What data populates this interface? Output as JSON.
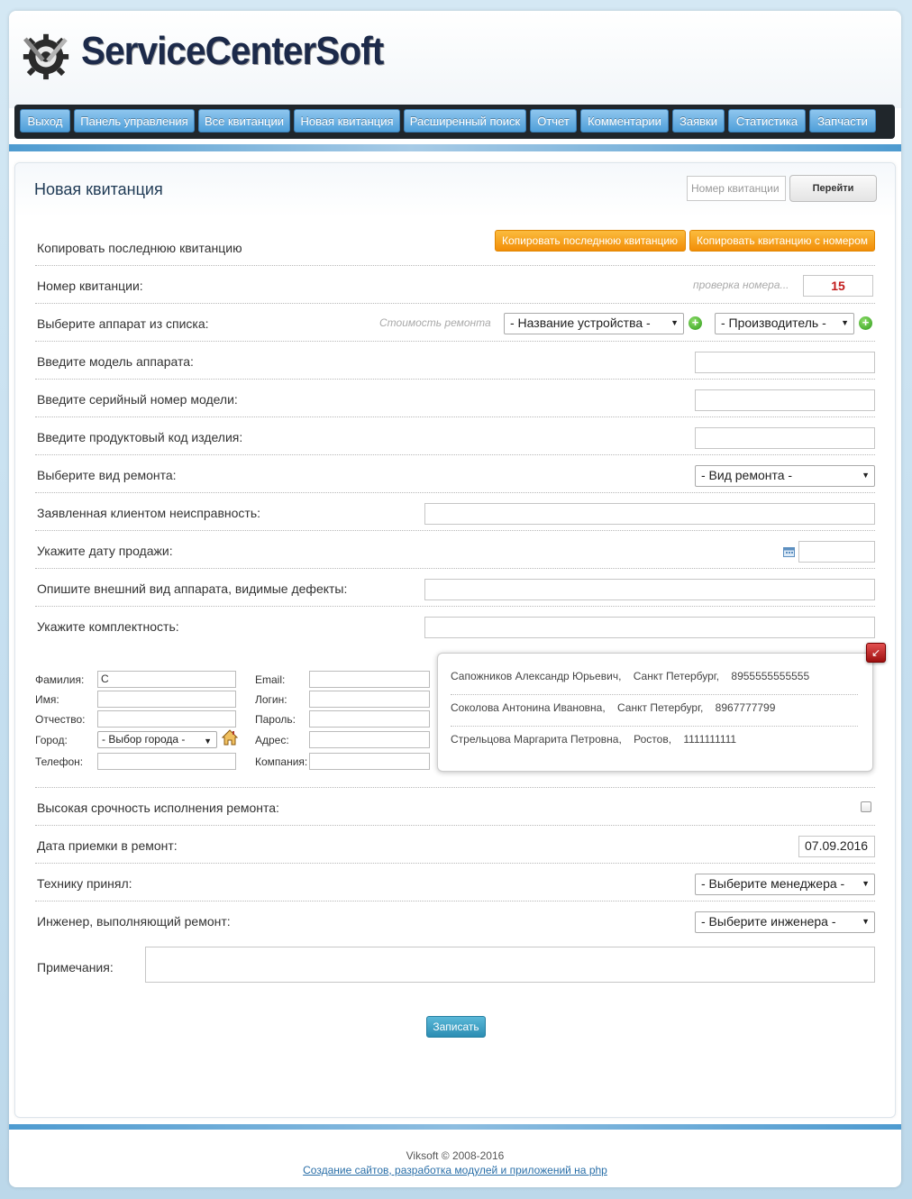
{
  "app": {
    "title": "ServiceCenterSoft"
  },
  "nav": [
    "Выход",
    "Панель управления",
    "Все квитанции",
    "Новая квитанция",
    "Расширенный поиск",
    "Отчет",
    "Комментарии",
    "Заявки",
    "Статистика",
    "Запчасти"
  ],
  "header": {
    "page_title": "Новая квитанция",
    "goto_placeholder": "Номер квитанции",
    "goto_button": "Перейти"
  },
  "form": {
    "copy_label": "Копировать последнюю квитанцию",
    "copy_last_button": "Копировать последнюю квитанцию",
    "copy_number_button": "Копировать квитанцию с номером",
    "receipt_number_label": "Номер квитанции:",
    "receipt_number_hint": "проверка номера...",
    "receipt_number_value": "15",
    "device_label": "Выберите аппарат из списка:",
    "repair_cost_hint": "Стоимость ремонта",
    "device_select": "- Название устройства -",
    "manufacturer_select": "- Производитель -",
    "model_label": "Введите модель аппарата:",
    "serial_label": "Введите серийный номер модели:",
    "product_code_label": "Введите продуктовый код изделия:",
    "repair_type_label": "Выберите вид ремонта:",
    "repair_type_select": "- Вид ремонта -",
    "fault_label": "Заявленная клиентом неисправность:",
    "sale_date_label": "Укажите дату продажи:",
    "appearance_label": "Опишите внешний вид аппарата, видимые дефекты:",
    "completeness_label": "Укажите комплектность:",
    "urgency_label": "Высокая срочность исполнения ремонта:",
    "intake_date_label": "Дата приемки в ремонт:",
    "intake_date_value": "07.09.2016",
    "accepted_label": "Технику принял:",
    "manager_select": "- Выберите менеджера -",
    "engineer_label": "Инженер, выполняющий ремонт:",
    "engineer_select": "- Выберите инженера -",
    "notes_label": "Примечания:",
    "submit_button": "Записать"
  },
  "client": {
    "last_name_label": "Фамилия:",
    "last_name_value": "С",
    "first_name_label": "Имя:",
    "patronymic_label": "Отчество:",
    "city_label": "Город:",
    "city_select": "- Выбор города -",
    "phone_label": "Телефон:",
    "email_label": "Email:",
    "login_label": "Логин:",
    "password_label": "Пароль:",
    "address_label": "Адрес:",
    "company_label": "Компания:"
  },
  "suggestions": [
    "Сапожников Александр Юрьевич,    Санкт Петербург,    8955555555555",
    "Соколова Антонина Ивановна,    Санкт Петербург,    8967777799",
    "Стрельцова Маргарита Петровна,    Ростов,    1111111111"
  ],
  "footer": {
    "copyright": "Viksoft © 2008-2016",
    "link": "Создание сайтов, разработка модулей и приложений на php"
  },
  "colors": {
    "accent": "#4f9fd9",
    "orange": "#f28e07",
    "nav_bg": "#20262b",
    "title": "#1c2a4a"
  }
}
